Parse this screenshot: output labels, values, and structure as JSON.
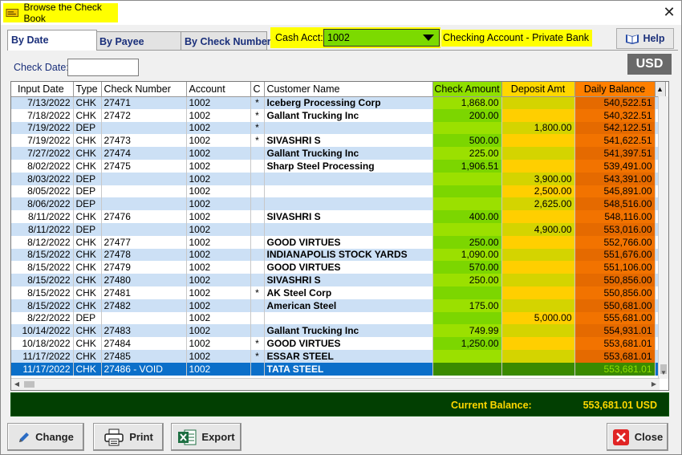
{
  "window": {
    "title": "Browse the Check Book",
    "close_glyph": "✕"
  },
  "tabs": [
    {
      "label": "By Date",
      "active": true
    },
    {
      "label": "By Payee",
      "active": false
    },
    {
      "label": "By Check Number",
      "active": false
    }
  ],
  "cash_acct": {
    "label": "Cash Acct:",
    "value": "1002",
    "description": "Checking Account - Private Bank"
  },
  "help": {
    "label": "Help",
    "icon": "help-book-icon"
  },
  "check_date": {
    "label": "Check Date:",
    "value": ""
  },
  "currency": "USD",
  "grid": {
    "columns": [
      "Input Date",
      "Type",
      "Check Number",
      "Account",
      "C",
      "Customer Name",
      "Check Amount",
      "Deposit Amt",
      "Daily Balance"
    ],
    "rows": [
      {
        "date": "7/13/2022",
        "type": "CHK",
        "num": "27471",
        "acct": "1002",
        "c": "*",
        "name": "Iceberg Processing Corp",
        "chk": "1,868.00",
        "dep": "",
        "bal": "540,522.51"
      },
      {
        "date": "7/18/2022",
        "type": "CHK",
        "num": "27472",
        "acct": "1002",
        "c": "*",
        "name": "Gallant Trucking Inc",
        "chk": "200.00",
        "dep": "",
        "bal": "540,322.51"
      },
      {
        "date": "7/19/2022",
        "type": "DEP",
        "num": "",
        "acct": "1002",
        "c": "*",
        "name": "",
        "chk": "",
        "dep": "1,800.00",
        "bal": "542,122.51"
      },
      {
        "date": "7/19/2022",
        "type": "CHK",
        "num": "27473",
        "acct": "1002",
        "c": "*",
        "name": "SIVASHRI S",
        "chk": "500.00",
        "dep": "",
        "bal": "541,622.51"
      },
      {
        "date": "7/27/2022",
        "type": "CHK",
        "num": "27474",
        "acct": "1002",
        "c": "",
        "name": "Gallant Trucking Inc",
        "chk": "225.00",
        "dep": "",
        "bal": "541,397.51"
      },
      {
        "date": "8/02/2022",
        "type": "CHK",
        "num": "27475",
        "acct": "1002",
        "c": "",
        "name": "Sharp Steel Processing",
        "chk": "1,906.51",
        "dep": "",
        "bal": "539,491.00"
      },
      {
        "date": "8/03/2022",
        "type": "DEP",
        "num": "",
        "acct": "1002",
        "c": "",
        "name": "",
        "chk": "",
        "dep": "3,900.00",
        "bal": "543,391.00"
      },
      {
        "date": "8/05/2022",
        "type": "DEP",
        "num": "",
        "acct": "1002",
        "c": "",
        "name": "",
        "chk": "",
        "dep": "2,500.00",
        "bal": "545,891.00"
      },
      {
        "date": "8/06/2022",
        "type": "DEP",
        "num": "",
        "acct": "1002",
        "c": "",
        "name": "",
        "chk": "",
        "dep": "2,625.00",
        "bal": "548,516.00"
      },
      {
        "date": "8/11/2022",
        "type": "CHK",
        "num": "27476",
        "acct": "1002",
        "c": "",
        "name": "SIVASHRI S",
        "chk": "400.00",
        "dep": "",
        "bal": "548,116.00"
      },
      {
        "date": "8/11/2022",
        "type": "DEP",
        "num": "",
        "acct": "1002",
        "c": "",
        "name": "",
        "chk": "",
        "dep": "4,900.00",
        "bal": "553,016.00"
      },
      {
        "date": "8/12/2022",
        "type": "CHK",
        "num": "27477",
        "acct": "1002",
        "c": "",
        "name": "GOOD VIRTUES",
        "chk": "250.00",
        "dep": "",
        "bal": "552,766.00"
      },
      {
        "date": "8/15/2022",
        "type": "CHK",
        "num": "27478",
        "acct": "1002",
        "c": "",
        "name": "INDIANAPOLIS STOCK YARDS",
        "chk": "1,090.00",
        "dep": "",
        "bal": "551,676.00"
      },
      {
        "date": "8/15/2022",
        "type": "CHK",
        "num": "27479",
        "acct": "1002",
        "c": "",
        "name": "GOOD VIRTUES",
        "chk": "570.00",
        "dep": "",
        "bal": "551,106.00"
      },
      {
        "date": "8/15/2022",
        "type": "CHK",
        "num": "27480",
        "acct": "1002",
        "c": "",
        "name": "SIVASHRI S",
        "chk": "250.00",
        "dep": "",
        "bal": "550,856.00"
      },
      {
        "date": "8/15/2022",
        "type": "CHK",
        "num": "27481",
        "acct": "1002",
        "c": "*",
        "name": "AK Steel Corp",
        "chk": "",
        "dep": "",
        "bal": "550,856.00"
      },
      {
        "date": "8/15/2022",
        "type": "CHK",
        "num": "27482",
        "acct": "1002",
        "c": "",
        "name": "American Steel",
        "chk": "175.00",
        "dep": "",
        "bal": "550,681.00"
      },
      {
        "date": "8/22/2022",
        "type": "DEP",
        "num": "",
        "acct": "1002",
        "c": "",
        "name": "",
        "chk": "",
        "dep": "5,000.00",
        "bal": "555,681.00"
      },
      {
        "date": "10/14/2022",
        "type": "CHK",
        "num": "27483",
        "acct": "1002",
        "c": "",
        "name": "Gallant Trucking Inc",
        "chk": "749.99",
        "dep": "",
        "bal": "554,931.01"
      },
      {
        "date": "10/18/2022",
        "type": "CHK",
        "num": "27484",
        "acct": "1002",
        "c": "*",
        "name": "GOOD VIRTUES",
        "chk": "1,250.00",
        "dep": "",
        "bal": "553,681.01"
      },
      {
        "date": "11/17/2022",
        "type": "CHK",
        "num": "27485",
        "acct": "1002",
        "c": "*",
        "name": "ESSAR STEEL",
        "chk": "",
        "dep": "",
        "bal": "553,681.01"
      },
      {
        "date": "11/17/2022",
        "type": "CHK",
        "num": "27486 - VOID",
        "acct": "1002",
        "c": "",
        "name": "TATA STEEL",
        "chk": "",
        "dep": "",
        "bal": "553,681.01",
        "selected": true
      }
    ]
  },
  "footer": {
    "label": "Current Balance:",
    "value": "553,681.01 USD"
  },
  "buttons": {
    "change": "Change",
    "print": "Print",
    "export": "Export",
    "close": "Close"
  },
  "colors": {
    "check_amount": "#7cd600",
    "deposit_amt": "#ffcf00",
    "daily_balance": "#f27300",
    "selected_row": "#0b6fc9",
    "footer_bg": "#023f02",
    "highlight": "#ffff00"
  }
}
